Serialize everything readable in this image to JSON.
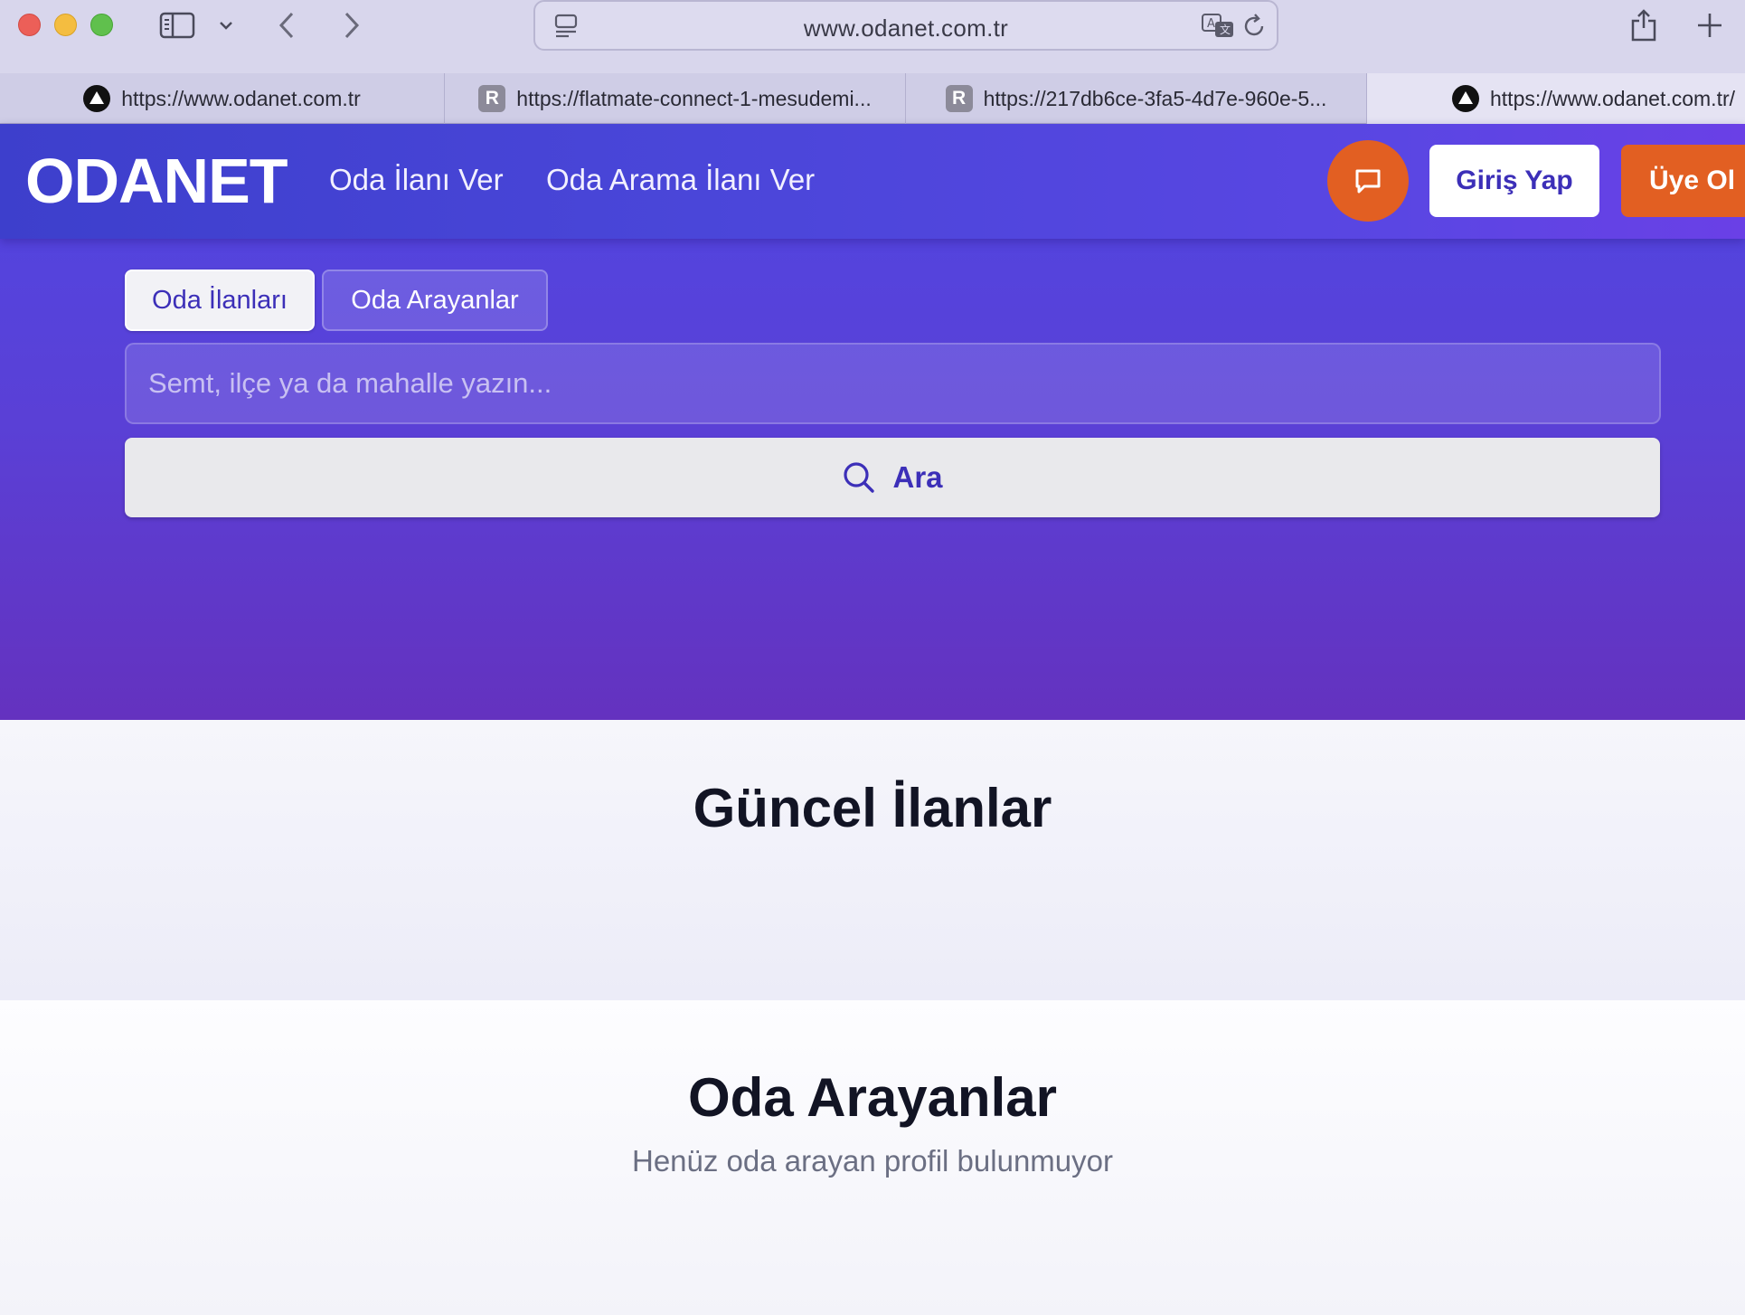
{
  "browser": {
    "url": "www.odanet.com.tr",
    "tabs": [
      {
        "label": "https://www.odanet.com.tr",
        "favicon": "triangle-logo",
        "active": false
      },
      {
        "label": "https://flatmate-connect-1-mesudemi...",
        "favicon": "R",
        "active": false
      },
      {
        "label": "https://217db6ce-3fa5-4d7e-960e-5...",
        "favicon": "R",
        "active": false
      },
      {
        "label": "https://www.odanet.com.tr/",
        "favicon": "triangle-logo",
        "active": true
      }
    ]
  },
  "header": {
    "logo": "ODANET",
    "nav": [
      "Oda İlanı Ver",
      "Oda Arama İlanı Ver"
    ],
    "messages_icon": "chat-bubble-icon",
    "login_label": "Giriş Yap",
    "register_label": "Üye Ol"
  },
  "search": {
    "tabs": [
      "Oda İlanları",
      "Oda Arayanlar"
    ],
    "active_tab": "Oda İlanları",
    "placeholder": "Semt, ilçe ya da mahalle yazın...",
    "value": "",
    "button_label": "Ara"
  },
  "sections": {
    "current_listings_title": "Güncel İlanlar",
    "seekers_title": "Oda Arayanlar",
    "seekers_empty_text": "Henüz oda arayan profil bulunmuyor"
  },
  "colors": {
    "primary": "#4f46e5",
    "accent": "#e25f22",
    "heading": "#121424"
  }
}
